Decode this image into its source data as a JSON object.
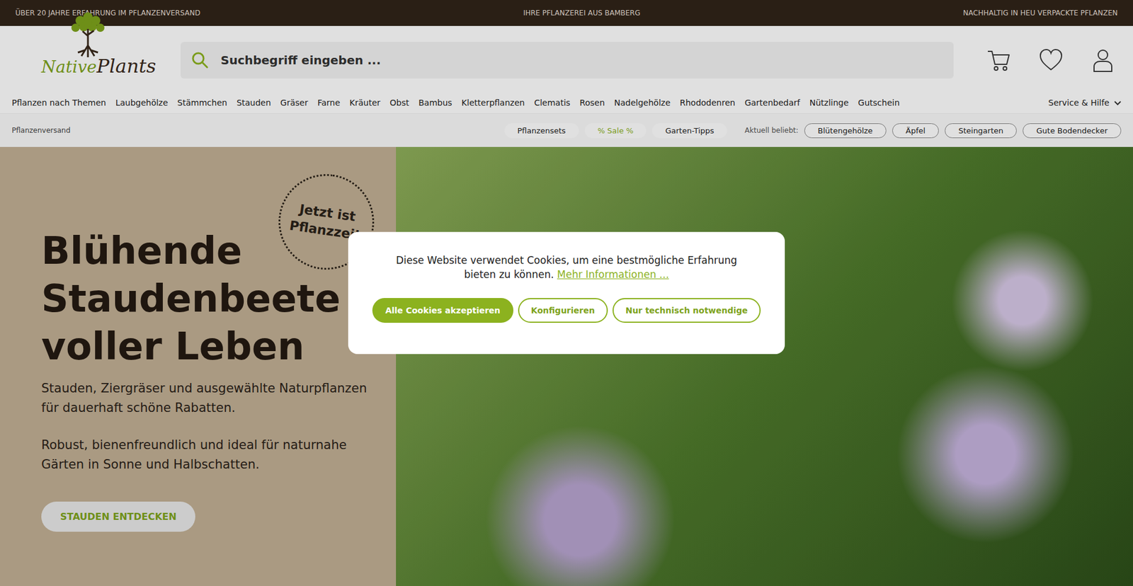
{
  "top_bar": [
    "ÜBER 20 JAHRE ERFAHRUNG IM PFLANZENVERSAND",
    "IHRE PFLANZEREI AUS BAMBERG",
    "NACHHALTIG IN HEU VERPACKTE PFLANZEN"
  ],
  "logo": {
    "part1": "Native",
    "part2": "Plants"
  },
  "search": {
    "placeholder": "Suchbegriff eingeben ..."
  },
  "nav": [
    "Pflanzen nach Themen",
    "Laubgehölze",
    "Stämmchen",
    "Stauden",
    "Gräser",
    "Farne",
    "Kräuter",
    "Obst",
    "Bambus",
    "Kletterpflanzen",
    "Clematis",
    "Rosen",
    "Nadelgehölze",
    "Rhododenren",
    "Gartenbedarf",
    "Nützlinge",
    "Gutschein"
  ],
  "service": {
    "label": "Service & Hilfe",
    "expanded": false
  },
  "breadcrumb": "Pflanzenversand",
  "chips": [
    {
      "label": "Pflanzensets",
      "highlight": false
    },
    {
      "label": "% Sale %",
      "highlight": true
    },
    {
      "label": "Garten-Tipps",
      "highlight": false
    }
  ],
  "popular_label": "Aktuell beliebt:",
  "popular": [
    "Blütengehölze",
    "Äpfel",
    "Steingarten",
    "Gute Bodendecker"
  ],
  "hero": {
    "badge": [
      "Jetzt ist",
      "Pflanzzeit"
    ],
    "title": [
      "Blühende",
      "Staudenbeete",
      "voller Leben"
    ],
    "paragraphs": [
      "Stauden, Ziergräser und ausgewählte Naturpflanzen für dauerhaft schöne Rabatten.",
      "Robust, bienenfreundlich und ideal für naturnahe Gärten in Sonne und Halbschatten."
    ],
    "button": "STAUDEN ENTDECKEN"
  },
  "cookie": {
    "text": "Diese Website verwendet Cookies, um eine bestmögliche Erfahrung bieten zu können.",
    "link": "Mehr Informationen ...",
    "buttons": [
      {
        "label": "Alle Cookies akzeptieren",
        "primary": true
      },
      {
        "label": "Konfigurieren",
        "primary": false
      },
      {
        "label": "Nur technisch notwendige",
        "primary": false
      }
    ]
  }
}
